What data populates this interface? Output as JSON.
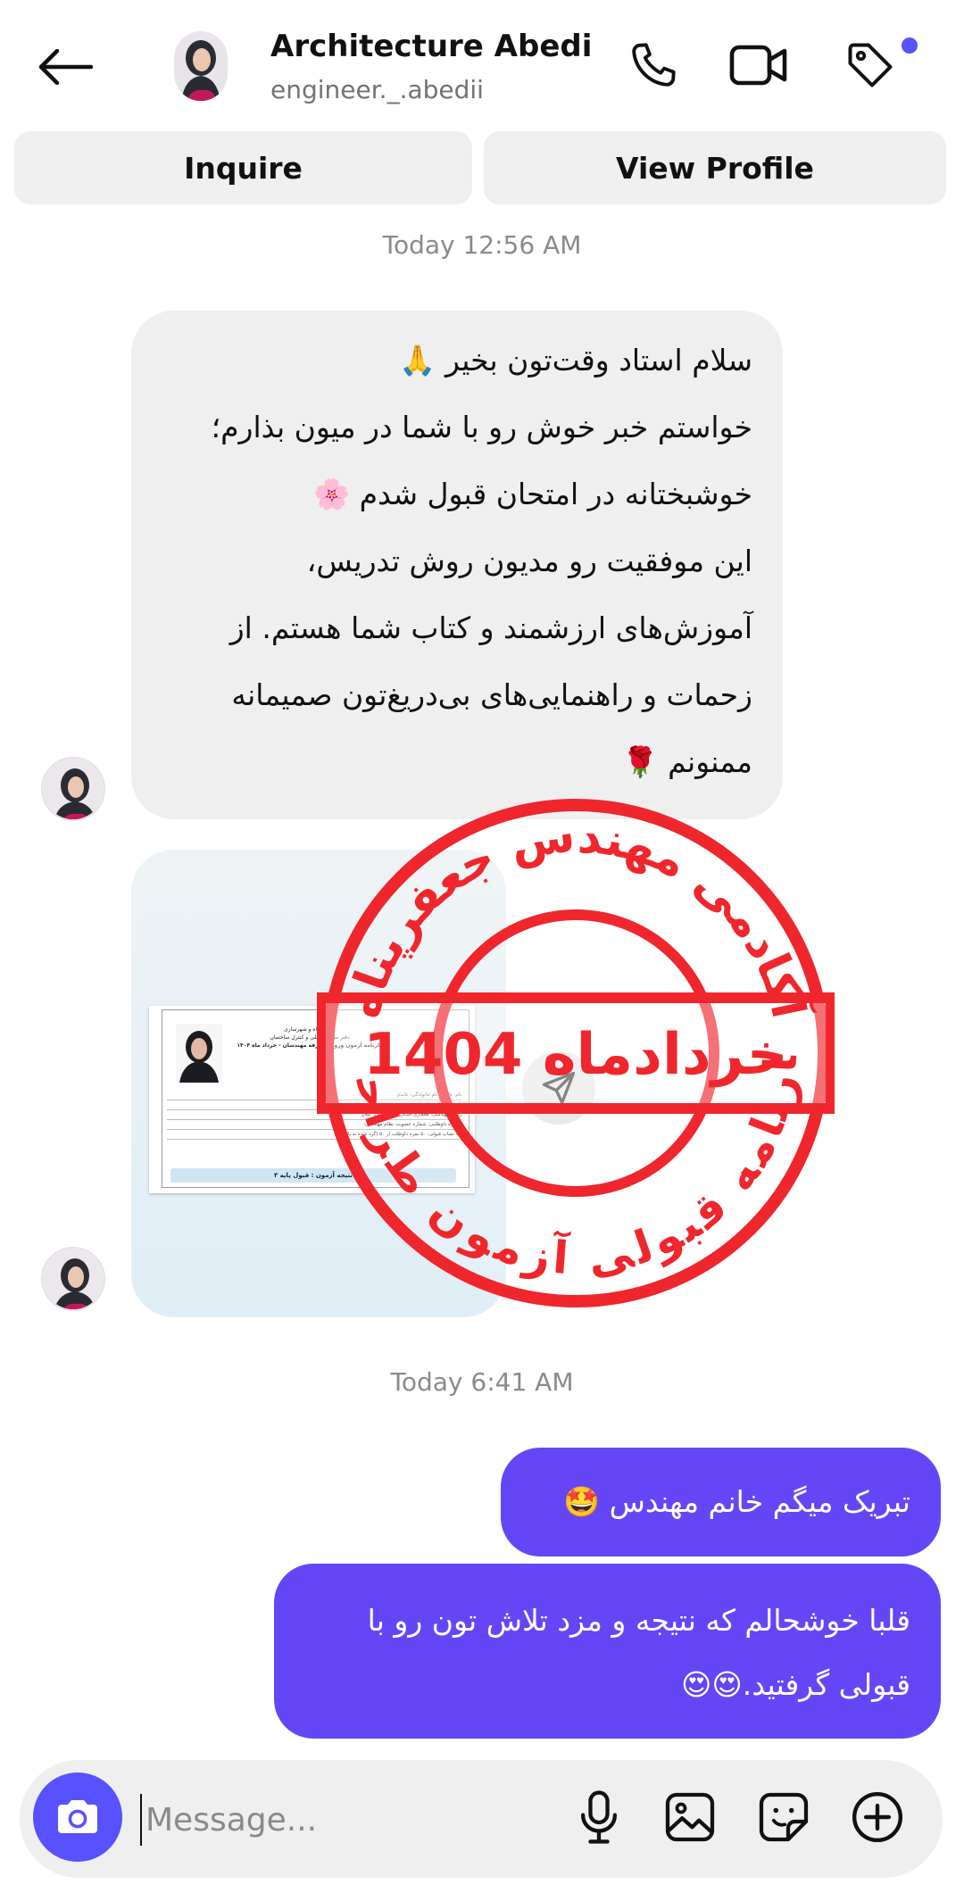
{
  "header": {
    "name": "Architecture Abedi",
    "username": "engineer._.abedii"
  },
  "actions": {
    "inquire": "Inquire",
    "view_profile": "View Profile"
  },
  "timestamps": {
    "first": "Today 12:56 AM",
    "second": "Today 6:41 AM"
  },
  "messages": {
    "incoming_text": {
      "lines": [
        "سلام استاد وقت‌تون بخیر 🙏",
        "خواستم خبر خوش رو با شما در میون بذارم؛",
        "خوشبختانه در امتحان قبول شدم 🌸",
        "این موفقیت رو مدیون روش تدریس،",
        "آموزش‌های ارزشمند و کتاب شما هستم. از",
        "زحمات و راهنمایی‌های بی‌دریغ‌تون صمیمانه",
        "ممنونم 🌹"
      ]
    },
    "outgoing_1": "تبریک میگم خانم مهندس 🤩",
    "outgoing_2": {
      "line1": "قلبا خوشحالم که نتیجه و مزد تلاش تون رو با",
      "line2": "قبولی گرفتید.😍😍"
    }
  },
  "stamp": {
    "top_arc": "آکادمی مهندس جعفرپناه",
    "center": "خردادماه 1404",
    "bottom_arc": "کارنامه قبولی آزمون طراحی"
  },
  "document": {
    "header_line1": "وزارت راه و شهرسازی",
    "header_line2": "دفتر مقررات ملی و کنترل ساختمان",
    "header_line3": "کارنامه آزمون ورود به حرفه مهندسان - خرداد ماه ۱۴۰۴",
    "rows": [
      "نام: فاطمه          نام خانوادگی: عابدی",
      "نام پدر:            سال تولد: ۷۵",
      "رشته مهندسی: معماری  استان محل آزمون: گیلان",
      "شماره داوطلبی:      شماره عضویت نظام مهندسی:",
      "حد نصاب قبولی: ۵۰   نمره داوطلب از ۵۰ (گرد شده به بالا): ۳۹"
    ],
    "result": "نتیجه آزمون : قبول پایه ۳"
  },
  "composer": {
    "placeholder": "Message..."
  },
  "colors": {
    "accent": "#5851ff",
    "outgoing_bubble": "#6546f7",
    "incoming_bubble": "#efefef",
    "stamp_red": "#f0262d"
  },
  "icons": [
    "back-arrow-icon",
    "phone-icon",
    "video-icon",
    "tag-icon",
    "send-icon",
    "camera-icon",
    "microphone-icon",
    "gallery-icon",
    "sticker-icon",
    "plus-icon"
  ]
}
